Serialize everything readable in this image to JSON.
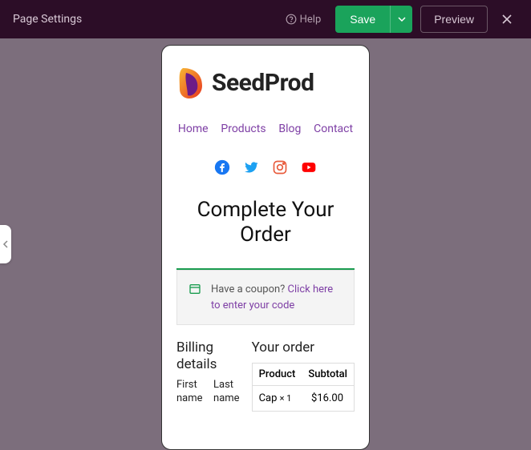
{
  "header": {
    "title": "Page Settings",
    "help_label": "Help",
    "save_label": "Save",
    "preview_label": "Preview"
  },
  "page": {
    "brand": "SeedProd",
    "nav": [
      "Home",
      "Products",
      "Blog",
      "Contact"
    ],
    "heading": "Complete Your Order",
    "coupon_prompt": "Have a coupon?",
    "coupon_link": "Click here to enter your code",
    "billing": {
      "title": "Billing details",
      "first_name_label": "First name",
      "last_name_label": "Last name"
    },
    "order": {
      "title": "Your order",
      "cols": {
        "product": "Product",
        "subtotal": "Subtotal"
      },
      "items": [
        {
          "name": "Cap",
          "qty": "× 1",
          "price": "$16.00"
        }
      ]
    }
  }
}
